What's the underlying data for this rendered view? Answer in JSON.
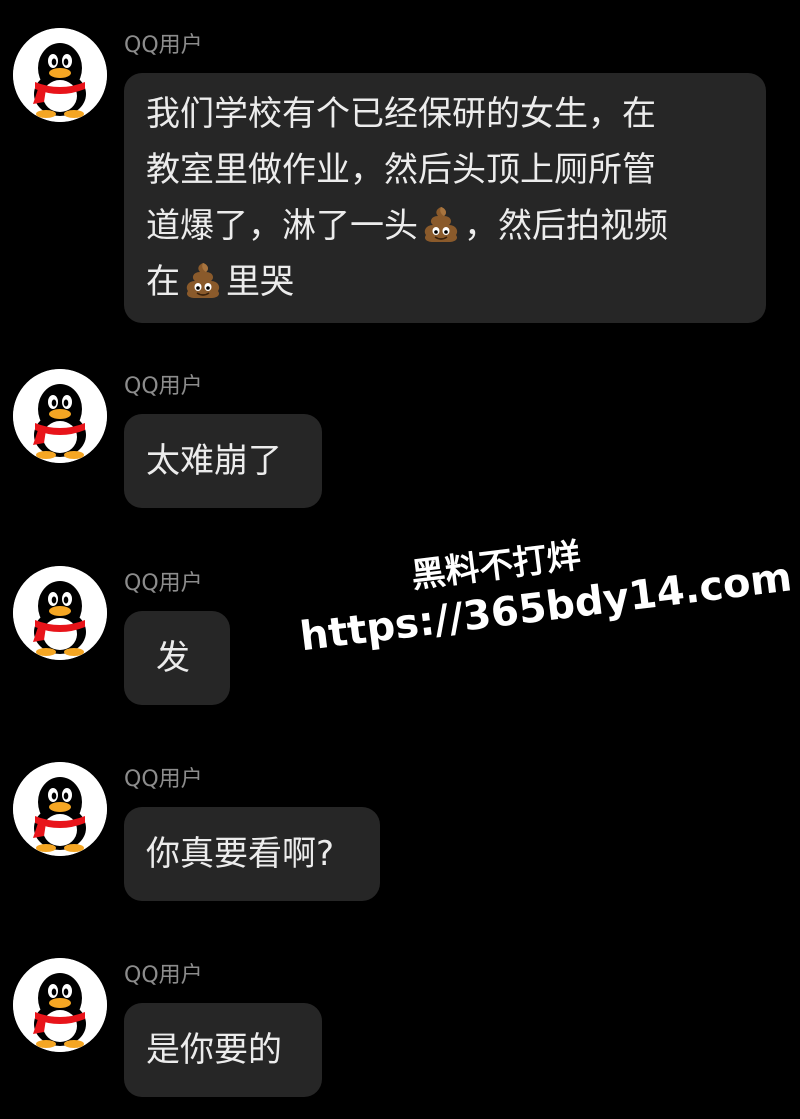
{
  "messages": [
    {
      "sender": "QQ用户",
      "avatar_icon": "qq-penguin-icon",
      "text_line1": "我们学校有个已经保研的女生，在",
      "text_line2": "教室里做作业，然后头顶上厕所管",
      "text_line3a": "道爆了，淋了一头",
      "text_line3b": "，然后拍视频",
      "text_line4a": "在",
      "text_line4b": "里哭",
      "emoji_icon": "poop-emoji-icon"
    },
    {
      "sender": "QQ用户",
      "avatar_icon": "qq-penguin-icon",
      "text": "太难崩了"
    },
    {
      "sender": "QQ用户",
      "avatar_icon": "qq-penguin-icon",
      "text": "发"
    },
    {
      "sender": "QQ用户",
      "avatar_icon": "qq-penguin-icon",
      "text": "你真要看啊?"
    },
    {
      "sender": "QQ用户",
      "avatar_icon": "qq-penguin-icon",
      "text": "是你要的"
    }
  ],
  "watermark": {
    "line1": "黑料不打烊",
    "line2": "https://365bdy14.com"
  },
  "colors": {
    "background": "#000000",
    "bubble": "#262626",
    "bubble_text": "#ececec",
    "sender_text": "#8c8c8c",
    "avatar_bg": "#ffffff",
    "penguin_scarf": "#e8141a",
    "penguin_beak": "#f5a623"
  }
}
